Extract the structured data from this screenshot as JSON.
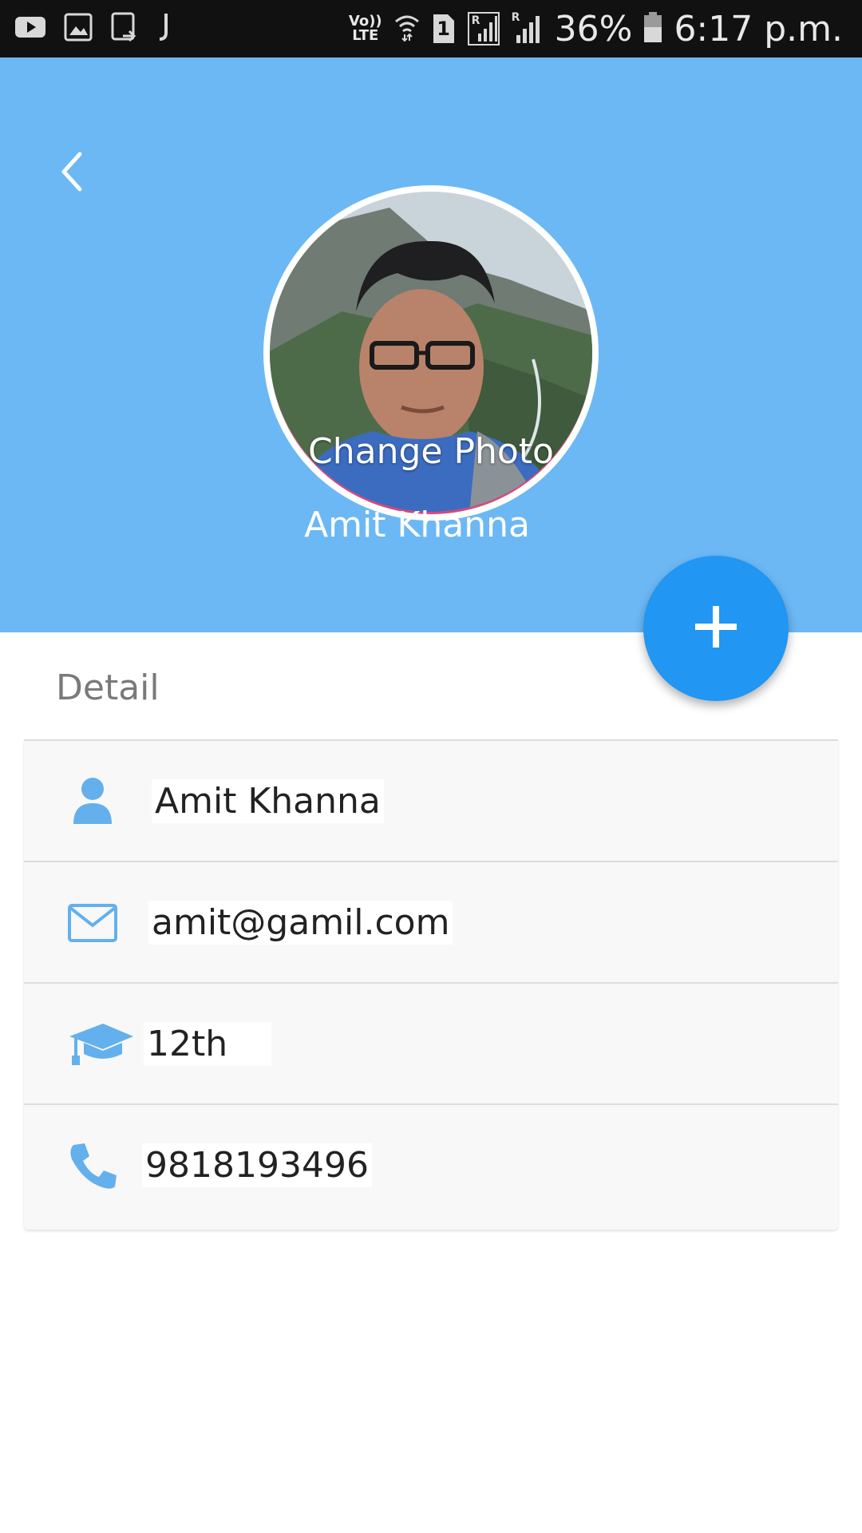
{
  "status_bar": {
    "battery": "36%",
    "time": "6:17 p.m.",
    "volte_top": "Vo))",
    "volte_bottom": "LTE",
    "sim_number": "1",
    "roaming_1": "R",
    "roaming_2": "R",
    "left_icons": [
      "youtube-icon",
      "gallery-icon",
      "screen-share-icon",
      "jio-icon"
    ],
    "right_icons": [
      "volte-icon",
      "wifi-icon",
      "sim-icon",
      "signal-roaming-icon",
      "signal-icon",
      "battery-icon"
    ]
  },
  "header": {
    "back_icon": "chevron-left-icon",
    "change_photo_label": "Change Photo",
    "profile_name": "Amit Khanna",
    "background_color": "#6cb8f5"
  },
  "fab": {
    "icon": "plus-icon",
    "color": "#2196f3"
  },
  "detail": {
    "title": "Detail",
    "rows": [
      {
        "icon": "person-icon",
        "value": "Amit Khanna"
      },
      {
        "icon": "envelope-icon",
        "value": "amit@gamil.com"
      },
      {
        "icon": "graduation-cap-icon",
        "value": "12th"
      },
      {
        "icon": "phone-icon",
        "value": "9818193496"
      }
    ],
    "icon_color": "#64b0ec"
  }
}
